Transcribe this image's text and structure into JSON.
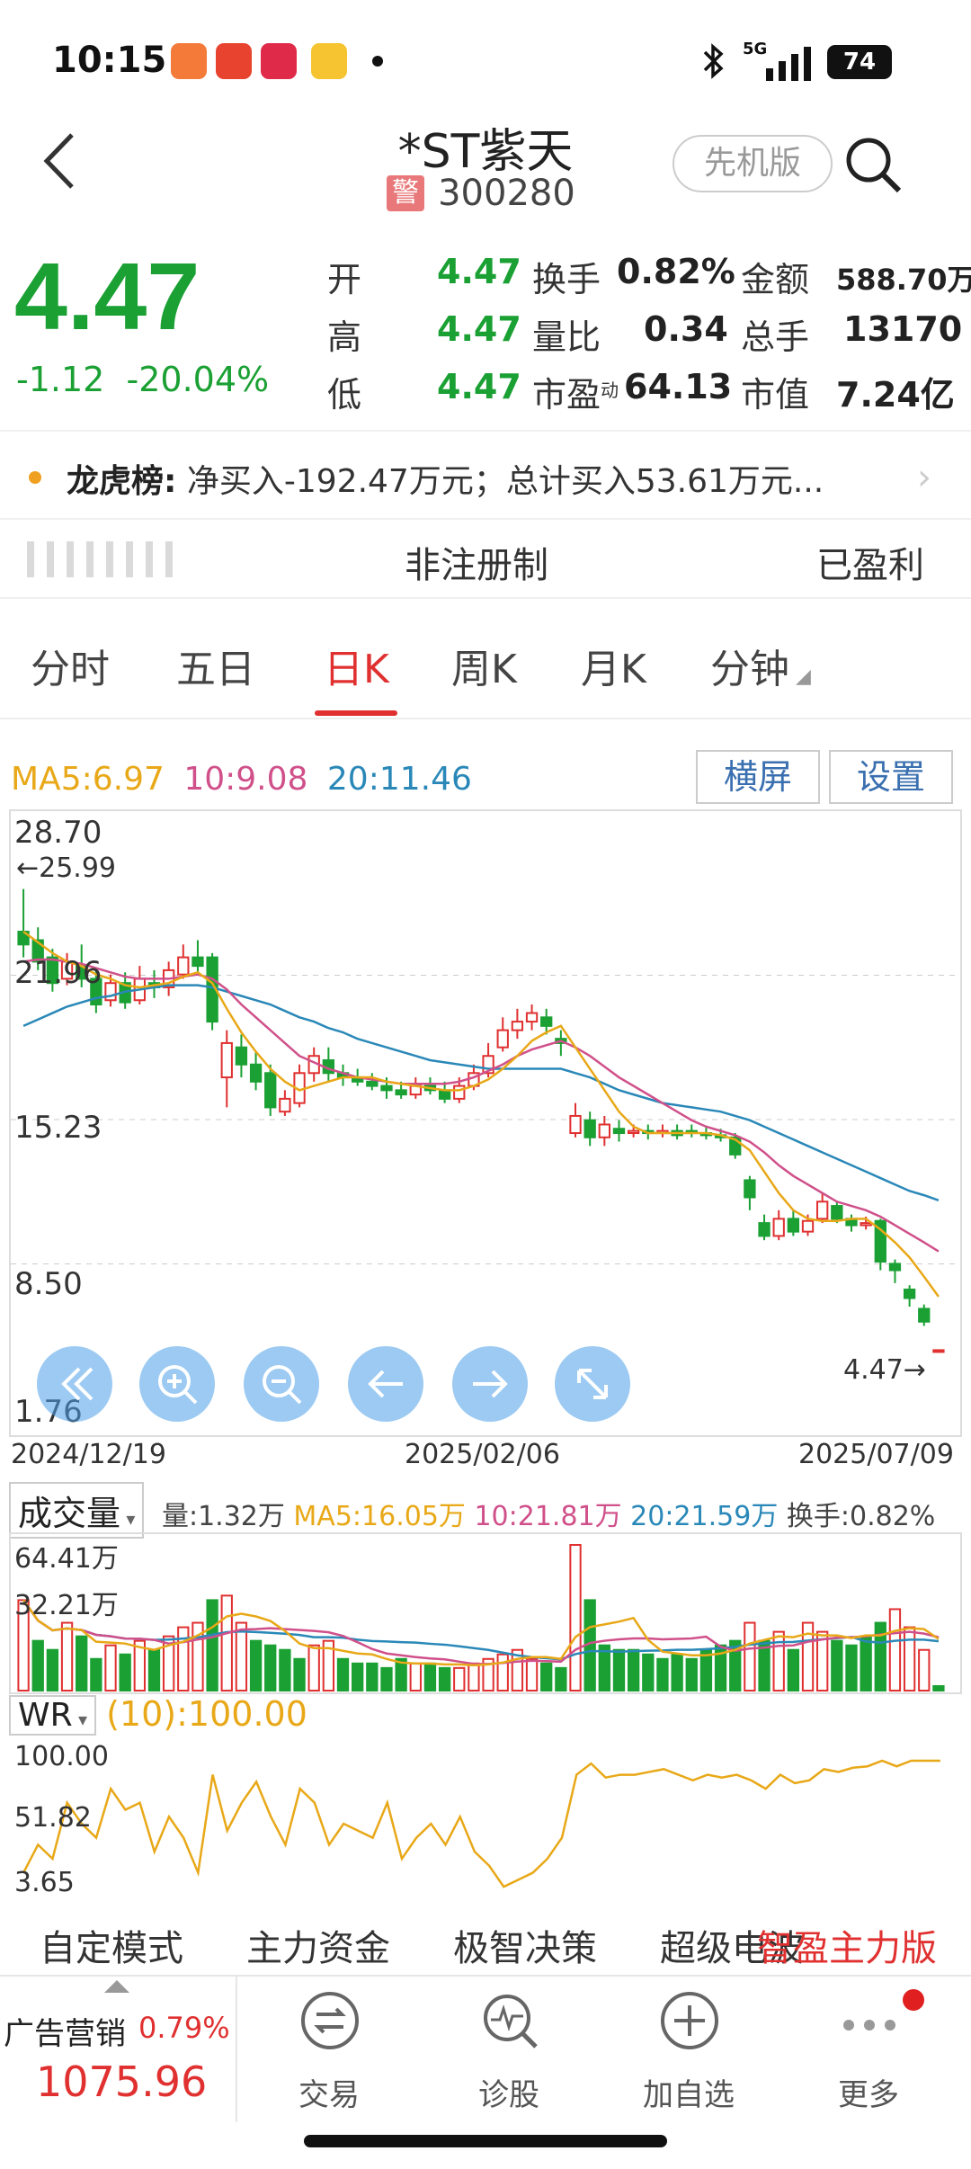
{
  "status_bar": {
    "time": "10:15",
    "network": "5G",
    "battery": "74",
    "app_icons": [
      {
        "name": "app-icon-1",
        "color": "#f47a3a"
      },
      {
        "name": "app-icon-2",
        "color": "#e8432e"
      },
      {
        "name": "app-icon-3",
        "color": "#e02a4a"
      },
      {
        "name": "app-icon-4",
        "color": "#f5c430"
      }
    ]
  },
  "header": {
    "stock_name": "*ST紫天",
    "warn_badge": "警",
    "stock_code": "300280",
    "version_button": "先机版"
  },
  "quote": {
    "price": "4.47",
    "change": "-1.12",
    "change_pct": "-20.04%",
    "rows": [
      {
        "l1": "开",
        "v1": "4.47",
        "l2": "换手",
        "v2": "0.82%",
        "l3": "金额",
        "v3": "588.70万"
      },
      {
        "l1": "高",
        "v1": "4.47",
        "l2": "量比",
        "v2": "0.34",
        "l3": "总手",
        "v3": "13170"
      },
      {
        "l1": "低",
        "v1": "4.47",
        "l2": "市盈",
        "l2_sup": "动",
        "v2": "64.13",
        "l3": "市值",
        "v3": "7.24亿"
      }
    ]
  },
  "dragon_tiger": {
    "label": "龙虎榜:",
    "text": "净买入-192.47万元；总计买入53.61万元..."
  },
  "tags": {
    "middle": "非注册制",
    "right": "已盈利"
  },
  "tabs": [
    {
      "label": "分时",
      "active": false
    },
    {
      "label": "五日",
      "active": false
    },
    {
      "label": "日K",
      "active": true
    },
    {
      "label": "周K",
      "active": false
    },
    {
      "label": "月K",
      "active": false
    },
    {
      "label": "分钟",
      "active": false
    }
  ],
  "ma": {
    "ma5": "MA5:6.97",
    "ma10": "10:9.08",
    "ma20": "20:11.46",
    "landscape_button": "横屏",
    "settings_button": "设置"
  },
  "colors": {
    "up": "#e03030",
    "down": "#1aa033",
    "ma5": "#e8a818",
    "ma10": "#d0508a",
    "ma20": "#2a88b8"
  },
  "kline": {
    "price_labels": [
      "28.70",
      "21.96",
      "15.23",
      "8.50",
      "1.76"
    ],
    "high_marker": "←25.99",
    "last_marker": "4.47→",
    "dates": [
      "2024/12/19",
      "2025/02/06",
      "2025/07/09"
    ],
    "ylim": [
      1.76,
      28.7
    ],
    "candles": [
      [
        24.0,
        23.4,
        25.99,
        22.8
      ],
      [
        23.6,
        22.6,
        24.2,
        22.2
      ],
      [
        22.8,
        21.6,
        23.2,
        21.2
      ],
      [
        21.8,
        22.6,
        23.0,
        21.5
      ],
      [
        22.4,
        21.8,
        23.4,
        21.4
      ],
      [
        21.8,
        20.6,
        22.2,
        20.2
      ],
      [
        20.8,
        21.6,
        22.0,
        20.5
      ],
      [
        21.6,
        20.7,
        22.1,
        20.4
      ],
      [
        20.8,
        21.8,
        22.4,
        20.6
      ],
      [
        21.6,
        21.4,
        22.2,
        20.9
      ],
      [
        21.4,
        22.2,
        22.6,
        21.0
      ],
      [
        22.0,
        22.8,
        23.4,
        21.8
      ],
      [
        22.8,
        22.4,
        23.6,
        22.0
      ],
      [
        22.8,
        19.8,
        23.0,
        19.4
      ],
      [
        17.2,
        18.8,
        19.4,
        15.8
      ],
      [
        18.6,
        17.8,
        19.2,
        17.2
      ],
      [
        17.8,
        17.0,
        18.4,
        16.6
      ],
      [
        17.4,
        15.8,
        17.8,
        15.4
      ],
      [
        15.6,
        16.2,
        16.6,
        15.4
      ],
      [
        16.0,
        17.4,
        17.8,
        15.8
      ],
      [
        17.4,
        18.2,
        18.6,
        17.0
      ],
      [
        18.0,
        17.4,
        18.6,
        17.0
      ],
      [
        17.4,
        17.2,
        17.8,
        16.8
      ],
      [
        17.2,
        17.0,
        17.6,
        16.8
      ],
      [
        17.0,
        16.8,
        17.4,
        16.6
      ],
      [
        16.8,
        16.6,
        17.2,
        16.2
      ],
      [
        16.6,
        16.4,
        17.0,
        16.2
      ],
      [
        16.4,
        16.8,
        17.2,
        16.2
      ],
      [
        16.8,
        16.6,
        17.2,
        16.4
      ],
      [
        16.6,
        16.2,
        17.0,
        16.0
      ],
      [
        16.2,
        16.8,
        17.2,
        16.0
      ],
      [
        16.8,
        17.4,
        17.8,
        16.6
      ],
      [
        17.4,
        18.2,
        18.8,
        17.2
      ],
      [
        18.6,
        19.4,
        20.0,
        18.4
      ],
      [
        19.4,
        19.8,
        20.4,
        19.0
      ],
      [
        19.8,
        20.2,
        20.6,
        19.4
      ],
      [
        20.0,
        19.6,
        20.4,
        19.2
      ],
      [
        19.0,
        18.8,
        19.4,
        18.2
      ],
      [
        14.6,
        15.4,
        16.0,
        14.4
      ],
      [
        15.2,
        14.4,
        15.6,
        14.0
      ],
      [
        14.4,
        15.0,
        15.4,
        14.0
      ],
      [
        14.8,
        14.6,
        15.2,
        14.2
      ],
      [
        14.6,
        14.7,
        15.0,
        14.4
      ],
      [
        14.7,
        14.6,
        15.0,
        14.3
      ],
      [
        14.6,
        14.7,
        15.0,
        14.4
      ],
      [
        14.7,
        14.5,
        15.0,
        14.3
      ],
      [
        14.7,
        14.6,
        15.0,
        14.4
      ],
      [
        14.6,
        14.5,
        14.9,
        14.3
      ],
      [
        14.5,
        14.4,
        14.8,
        14.2
      ],
      [
        14.4,
        13.6,
        14.6,
        13.4
      ],
      [
        12.4,
        11.6,
        12.6,
        11.0
      ],
      [
        10.4,
        9.8,
        10.8,
        9.6
      ],
      [
        9.8,
        10.6,
        11.0,
        9.6
      ],
      [
        10.6,
        10.0,
        11.0,
        9.8
      ],
      [
        10.0,
        10.5,
        10.8,
        9.8
      ],
      [
        10.6,
        11.4,
        11.8,
        10.4
      ],
      [
        11.2,
        10.6,
        11.4,
        10.4
      ],
      [
        10.6,
        10.3,
        10.8,
        10.0
      ],
      [
        10.3,
        10.4,
        10.7,
        10.1
      ],
      [
        10.5,
        8.6,
        10.6,
        8.2
      ],
      [
        8.5,
        8.2,
        8.7,
        7.6
      ],
      [
        7.3,
        6.9,
        7.5,
        6.5
      ],
      [
        6.4,
        5.8,
        6.6,
        5.6
      ],
      [
        4.47,
        4.47,
        4.47,
        4.47
      ]
    ],
    "ma5": [
      24.0,
      23.5,
      23.0,
      22.6,
      22.4,
      22.0,
      21.8,
      21.5,
      21.4,
      21.5,
      21.6,
      21.9,
      22.1,
      21.6,
      20.4,
      19.3,
      18.4,
      17.6,
      17.0,
      16.6,
      16.8,
      17.0,
      17.2,
      17.2,
      17.2,
      17.0,
      16.9,
      16.8,
      16.7,
      16.6,
      16.6,
      16.8,
      17.1,
      17.6,
      18.2,
      18.9,
      19.3,
      19.6,
      18.6,
      17.6,
      16.6,
      15.6,
      14.9,
      14.6,
      14.6,
      14.6,
      14.6,
      14.6,
      14.5,
      14.3,
      13.8,
      12.8,
      11.8,
      11.0,
      10.6,
      10.5,
      10.5,
      10.6,
      10.6,
      10.1,
      9.5,
      8.8,
      7.9,
      6.97
    ],
    "ma10": [
      22.6,
      22.7,
      22.7,
      22.6,
      22.5,
      22.3,
      22.1,
      21.9,
      21.8,
      21.8,
      21.8,
      21.9,
      22.0,
      21.8,
      21.3,
      20.6,
      20.0,
      19.4,
      18.8,
      18.2,
      17.9,
      17.6,
      17.4,
      17.2,
      17.1,
      17.0,
      16.9,
      16.9,
      16.9,
      16.9,
      17.0,
      17.2,
      17.5,
      17.8,
      18.2,
      18.5,
      18.7,
      18.9,
      18.6,
      18.2,
      17.7,
      17.2,
      16.8,
      16.4,
      16.0,
      15.6,
      15.2,
      14.9,
      14.7,
      14.5,
      14.2,
      13.7,
      13.1,
      12.6,
      12.2,
      11.8,
      11.4,
      11.2,
      11.0,
      10.7,
      10.3,
      9.9,
      9.5,
      9.08
    ],
    "ma20": [
      19.6,
      19.9,
      20.2,
      20.5,
      20.7,
      20.9,
      21.0,
      21.2,
      21.3,
      21.4,
      21.5,
      21.5,
      21.5,
      21.4,
      21.2,
      21.0,
      20.8,
      20.6,
      20.3,
      20.0,
      19.8,
      19.5,
      19.3,
      19.0,
      18.8,
      18.6,
      18.4,
      18.2,
      18.0,
      17.9,
      17.8,
      17.7,
      17.6,
      17.6,
      17.6,
      17.6,
      17.6,
      17.6,
      17.4,
      17.2,
      16.9,
      16.6,
      16.4,
      16.2,
      16.0,
      15.9,
      15.8,
      15.7,
      15.6,
      15.4,
      15.2,
      14.9,
      14.6,
      14.3,
      14.0,
      13.7,
      13.4,
      13.1,
      12.8,
      12.5,
      12.2,
      11.9,
      11.7,
      11.46
    ]
  },
  "volume": {
    "select_label": "成交量",
    "amount": "量:1.32万",
    "ma5": "MA5:16.05万",
    "ma10": "10:21.81万",
    "ma20": "20:21.59万",
    "turnover": "换手:0.82%",
    "labels": [
      "64.41万",
      "32.21万"
    ],
    "ylim": [
      0,
      64.41
    ],
    "values": [
      40,
      22,
      18,
      30,
      24,
      14,
      20,
      16,
      22,
      18,
      24,
      28,
      30,
      40,
      42,
      30,
      22,
      20,
      18,
      14,
      20,
      22,
      14,
      12,
      12,
      10,
      14,
      12,
      12,
      10,
      10,
      12,
      14,
      16,
      18,
      14,
      12,
      10,
      64.41,
      40,
      20,
      18,
      18,
      16,
      14,
      16,
      14,
      18,
      20,
      22,
      30,
      22,
      26,
      18,
      30,
      26,
      22,
      20,
      24,
      30,
      36,
      28,
      18,
      2
    ],
    "up": [
      true,
      false,
      false,
      true,
      false,
      false,
      true,
      false,
      true,
      false,
      true,
      true,
      true,
      false,
      true,
      true,
      false,
      false,
      false,
      false,
      true,
      true,
      false,
      false,
      false,
      false,
      false,
      true,
      false,
      false,
      true,
      true,
      true,
      true,
      true,
      true,
      false,
      false,
      true,
      false,
      false,
      false,
      false,
      false,
      false,
      false,
      false,
      false,
      false,
      false,
      true,
      false,
      true,
      false,
      true,
      true,
      false,
      false,
      false,
      false,
      true,
      true,
      true,
      false
    ]
  },
  "wr": {
    "select_label": "WR",
    "value": "(10):100.00",
    "labels": [
      "100.00",
      "51.82",
      "3.65"
    ],
    "ylim": [
      3.65,
      100
    ],
    "values": [
      20,
      40,
      30,
      70,
      55,
      45,
      80,
      65,
      70,
      35,
      60,
      45,
      20,
      90,
      50,
      70,
      85,
      60,
      40,
      80,
      70,
      40,
      55,
      50,
      45,
      70,
      30,
      45,
      55,
      40,
      60,
      35,
      25,
      10,
      15,
      20,
      30,
      45,
      90,
      98,
      88,
      90,
      90,
      92,
      94,
      90,
      86,
      90,
      88,
      90,
      86,
      80,
      90,
      84,
      86,
      94,
      92,
      95,
      96,
      100,
      96,
      100,
      100,
      100
    ]
  },
  "modes": [
    {
      "label": "自定模式",
      "color": "#333333"
    },
    {
      "label": "主力资金",
      "color": "#333333"
    },
    {
      "label": "极智决策",
      "color": "#333333"
    },
    {
      "label": "超级电波",
      "color": "#333333"
    },
    {
      "label": "智盈主力版",
      "color": "#e03030"
    }
  ],
  "bottom_nav": {
    "index_name": "广告营销",
    "index_pct": "0.79%",
    "index_value": "1075.96",
    "items": [
      "交易",
      "诊股",
      "加自选",
      "更多"
    ]
  }
}
